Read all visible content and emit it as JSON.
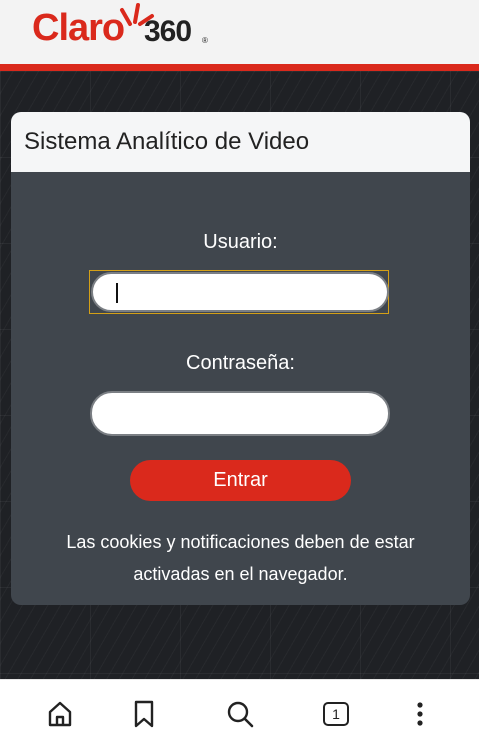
{
  "header": {
    "logo": {
      "brand": "Claro",
      "suffix": "360",
      "reg": "®"
    }
  },
  "card": {
    "title": "Sistema Analítico de Video",
    "username_label": "Usuario:",
    "username_value": "",
    "password_label": "Contraseña:",
    "password_value": "",
    "submit_label": "Entrar",
    "notice": "Las cookies y notificaciones deben de estar activadas en el navegador."
  },
  "bottom_nav": {
    "items": [
      {
        "icon": "home-icon"
      },
      {
        "icon": "bookmark-icon"
      },
      {
        "icon": "search-icon"
      },
      {
        "icon": "tabs-icon",
        "count": "1"
      },
      {
        "icon": "more-vertical-icon"
      }
    ]
  },
  "colors": {
    "brand_red": "#da291c",
    "card_bg": "#40464d",
    "header_bg": "#f3f3f3",
    "focus_ring": "#d4a017"
  }
}
